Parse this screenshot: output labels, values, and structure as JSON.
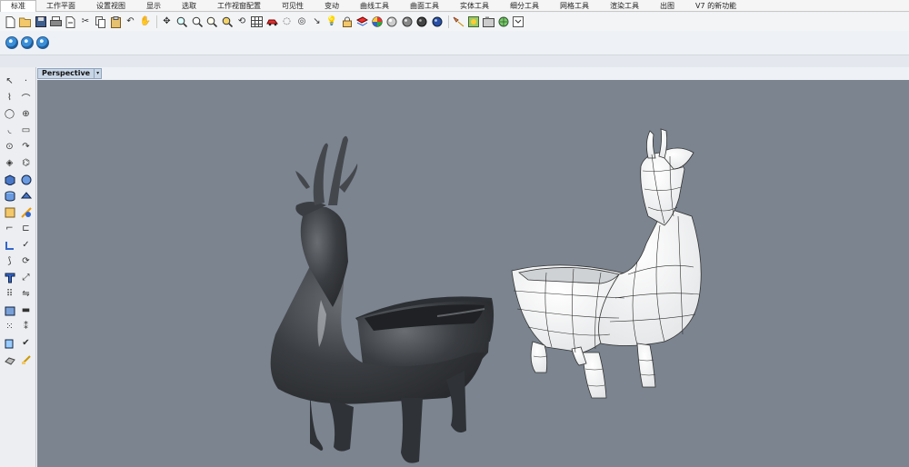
{
  "tabs": [
    {
      "label": "标准",
      "active": true
    },
    {
      "label": "工作平面"
    },
    {
      "label": "设置视图"
    },
    {
      "label": "显示"
    },
    {
      "label": "选取"
    },
    {
      "label": "工作视窗配置"
    },
    {
      "label": "可见性"
    },
    {
      "label": "变动"
    },
    {
      "label": "曲线工具"
    },
    {
      "label": "曲面工具"
    },
    {
      "label": "实体工具"
    },
    {
      "label": "细分工具"
    },
    {
      "label": "网格工具"
    },
    {
      "label": "渲染工具"
    },
    {
      "label": "出图"
    },
    {
      "label": "V7 的新功能"
    }
  ],
  "viewport": {
    "title": "Perspective",
    "dropdown_glyph": "▾",
    "background": "#7b848f"
  },
  "toolbar_icons": [
    "new-file",
    "open-folder",
    "save",
    "print",
    "import",
    "cut",
    "copy",
    "paste",
    "undo",
    "pan-hand",
    "move",
    "zoom-window",
    "zoom-extents",
    "zoom-selected",
    "rotate-view",
    "grid",
    "hide",
    "show",
    "lock",
    "unlock",
    "layer",
    "color-wheel",
    "material",
    "render",
    "render-sphere",
    "light",
    "snapshot",
    "camera",
    "env-map",
    "help"
  ],
  "colors": {
    "accent": "#3a8fd8",
    "solid_model": "#3c3f43",
    "wire_model": "#f4f4f4"
  }
}
